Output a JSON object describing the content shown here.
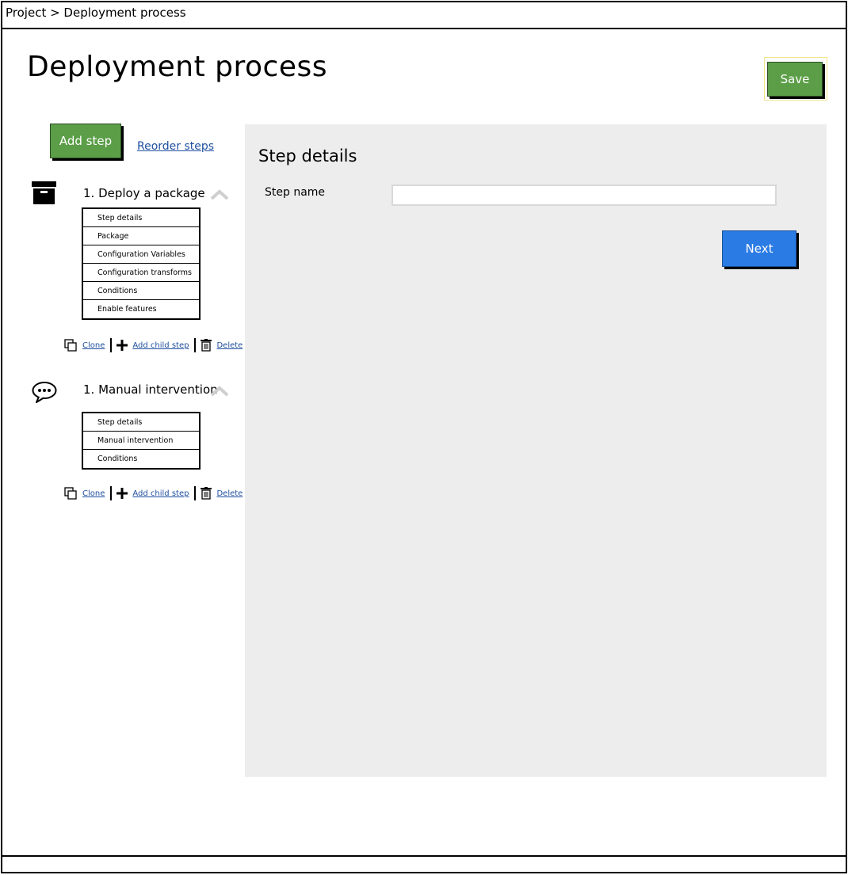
{
  "breadcrumb": "Project > Deployment process",
  "page": {
    "title": "Deployment process"
  },
  "toolbar": {
    "save_label": "Save",
    "add_step_label": "Add step",
    "reorder_label": "Reorder steps"
  },
  "steps": [
    {
      "icon": "package-icon",
      "title": "1. Deploy a package",
      "menu": [
        "Step details",
        "Package",
        "Configuration Variables",
        "Configuration transforms",
        "Conditions",
        "Enable features"
      ],
      "actions": {
        "clone": "Clone",
        "add_child": "Add child step",
        "delete": "Delete"
      }
    },
    {
      "icon": "speech-bubble-icon",
      "title": "1. Manual intervention",
      "menu": [
        "Step details",
        "Manual intervention",
        "Conditions"
      ],
      "actions": {
        "clone": "Clone",
        "add_child": "Add child step",
        "delete": "Delete"
      }
    }
  ],
  "details": {
    "title": "Step details",
    "step_name_label": "Step name",
    "step_name_value": "",
    "next_label": "Next"
  },
  "colors": {
    "green": "#5b9e47",
    "blue": "#2b7be4",
    "panel": "#ededed",
    "link": "#1f4f9e"
  }
}
